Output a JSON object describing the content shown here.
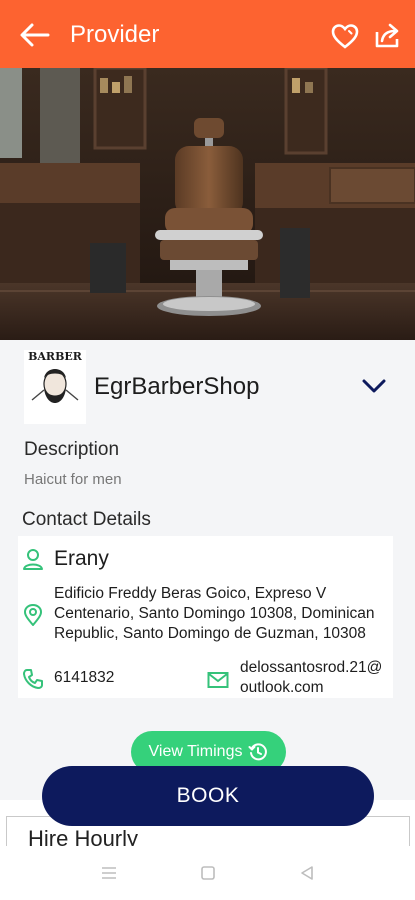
{
  "appbar": {
    "title": "Provider",
    "back_icon": "arrow-left-icon",
    "favorite_icon": "heart-icon",
    "share_icon": "share-icon",
    "color": "#fd6330"
  },
  "hero": {
    "description_icon": "barber-chair-photo"
  },
  "shop": {
    "name": "EgrBarberShop",
    "logo_text": "BARBER",
    "expand_icon": "chevron-down-icon"
  },
  "description": {
    "label": "Description",
    "text": "Haicut for men"
  },
  "contact": {
    "label": "Contact Details",
    "name": "Erany",
    "address": "Edificio Freddy Beras Goico, Expreso V Centenario, Santo Domingo 10308, Dominican Republic, Santo Domingo de Guzman, 10308",
    "phone": "6141832",
    "email": "delossantosrod.21@outlook.com",
    "accent": "#35c27a"
  },
  "actions": {
    "view_timings": "View Timings",
    "book": "BOOK",
    "book_color": "#0d1a5d"
  },
  "section": {
    "hire_hourly": "Hire Hourly"
  },
  "system_nav": {
    "recent_icon": "menu-icon",
    "home_icon": "square-icon",
    "back_icon": "triangle-back-icon"
  }
}
